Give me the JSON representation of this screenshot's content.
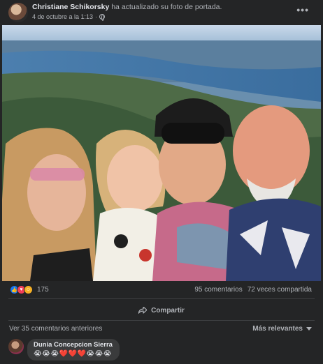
{
  "post": {
    "author": "Christiane Schikorsky",
    "action": "ha actualizado su foto de portada.",
    "date": "4 de octubre a la 1:13",
    "privacy_icon": "globe-icon",
    "more_icon": "more-options-icon",
    "more_label": "•••"
  },
  "reactions": {
    "types": [
      "like",
      "love",
      "care"
    ],
    "count": "175",
    "comments": "95 comentarios",
    "shares": "72 veces compartida"
  },
  "actions": {
    "share_label": "Compartir"
  },
  "comments_section": {
    "view_previous": "Ver 35 comentarios anteriores",
    "sort_label": "Más relevantes",
    "items": [
      {
        "author": "Dunia Concepcion Sierra",
        "text": "😭😭😭❤️❤️❤️😭😭😭"
      }
    ]
  },
  "colors": {
    "card_bg": "#242526",
    "text_primary": "#e4e6eb",
    "text_secondary": "#b0b3b8",
    "like_blue": "#1877f2",
    "love_red": "#f33e58"
  }
}
